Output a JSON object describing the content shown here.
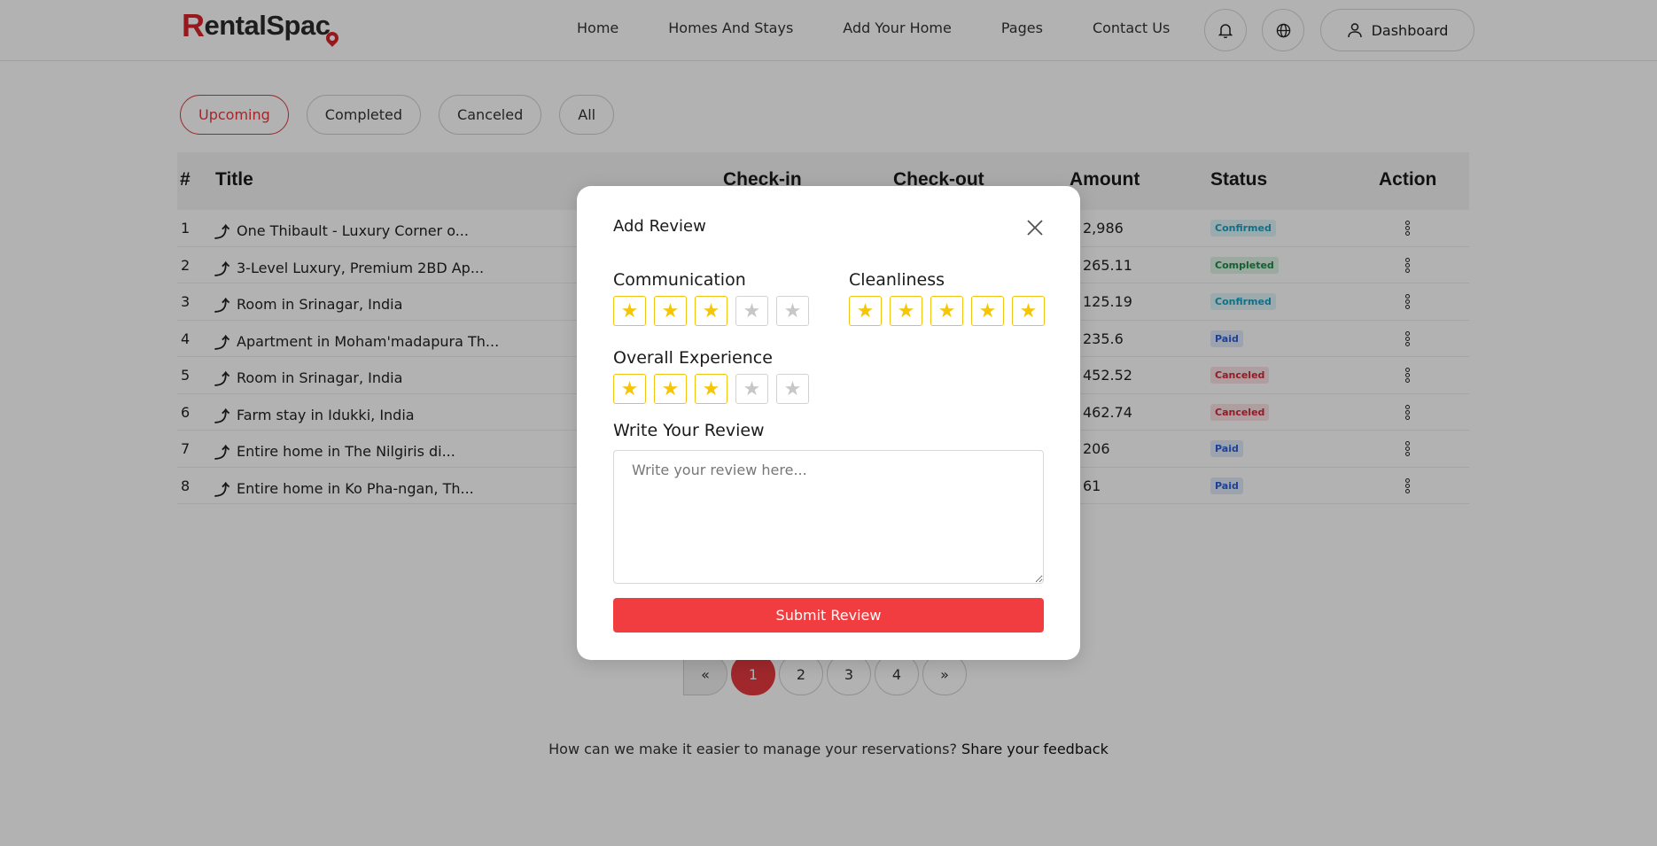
{
  "header": {
    "logo_initial": "R",
    "logo_rest": "entalSpac",
    "nav": [
      "Home",
      "Homes And Stays",
      "Add Your Home",
      "Pages",
      "Contact Us"
    ],
    "dashboard_label": "Dashboard"
  },
  "filters": [
    "Upcoming",
    "Completed",
    "Canceled",
    "All"
  ],
  "table": {
    "headers": {
      "num": "#",
      "title": "Title",
      "checkin": "Check-in",
      "checkout": "Check-out",
      "amount": "Amount",
      "status": "Status",
      "action": "Action"
    },
    "rows": [
      {
        "num": "1",
        "title": "One Thibault - Luxury Corner o...",
        "amount": "2,986",
        "status": "Confirmed",
        "kind": "confirmed"
      },
      {
        "num": "2",
        "title": "3-Level Luxury, Premium 2BD Ap...",
        "amount": "265.11",
        "status": "Completed",
        "kind": "completed"
      },
      {
        "num": "3",
        "title": "Room in Srinagar, India",
        "amount": "125.19",
        "status": "Confirmed",
        "kind": "confirmed"
      },
      {
        "num": "4",
        "title": "Apartment in Moham'madapura Th...",
        "amount": "235.6",
        "status": "Paid",
        "kind": "paid"
      },
      {
        "num": "5",
        "title": "Room in Srinagar, India",
        "amount": "452.52",
        "status": "Canceled",
        "kind": "canceled"
      },
      {
        "num": "6",
        "title": "Farm stay in Idukki, India",
        "amount": "462.74",
        "status": "Canceled",
        "kind": "canceled"
      },
      {
        "num": "7",
        "title": "Entire home in The Nilgiris di...",
        "amount": "206",
        "status": "Paid",
        "kind": "paid"
      },
      {
        "num": "8",
        "title": "Entire home in Ko Pha-ngan, Th...",
        "amount": "61",
        "status": "Paid",
        "kind": "paid"
      }
    ]
  },
  "pagination": {
    "prev": "«",
    "pages": [
      "1",
      "2",
      "3",
      "4"
    ],
    "next": "»",
    "current": "1"
  },
  "feedback": {
    "text": "How can we make it easier to manage your reservations?",
    "link": "Share your feedback"
  },
  "modal": {
    "title": "Add Review",
    "communication": {
      "label": "Communication",
      "rating": 3,
      "max": 5
    },
    "cleanliness": {
      "label": "Cleanliness",
      "rating": 5,
      "max": 5
    },
    "overall": {
      "label": "Overall Experience",
      "rating": 3,
      "max": 5
    },
    "review_label": "Write Your Review",
    "review_placeholder": "Write your review here...",
    "review_value": "",
    "submit_label": "Submit Review"
  },
  "colors": {
    "accent": "#f23d40",
    "star": "#f7c600"
  }
}
